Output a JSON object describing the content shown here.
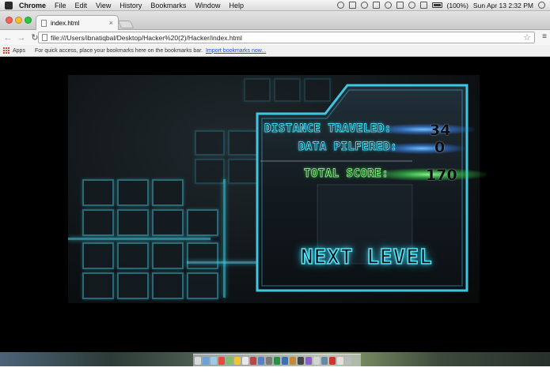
{
  "menubar": {
    "app_name": "Chrome",
    "items": [
      "File",
      "Edit",
      "View",
      "History",
      "Bookmarks",
      "Window",
      "Help"
    ],
    "battery": "(100%)",
    "datetime": "Sun Apr 13  2:32 PM"
  },
  "browser": {
    "tab_title": "index.html",
    "tab_close": "×",
    "url": "file:///Users/ibnatiqbal/Desktop/Hacker%20(2)/Hacker/index.html",
    "bookmarks_apps": "Apps",
    "bookmarks_hint": "For quick access, place your bookmarks here on the bookmarks bar.",
    "bookmarks_import": "Import bookmarks now..."
  },
  "game": {
    "distance_label": "DISTANCE TRAVELED:",
    "distance_value": "34",
    "data_label": "DATA PILFERED:",
    "data_value": "0",
    "total_label": "TOTAL SCORE:",
    "total_value": "170",
    "next_level_label": "NEXT LEVEL",
    "accent_color": "#4bd8ee",
    "score_color": "#7df07a"
  }
}
